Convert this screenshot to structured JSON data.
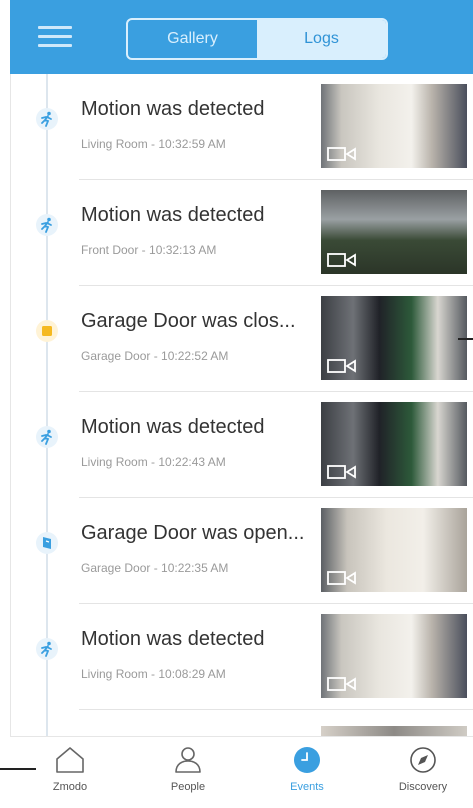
{
  "header": {
    "tabs": [
      {
        "label": "Gallery"
      },
      {
        "label": "Logs"
      }
    ]
  },
  "events": [
    {
      "title": "Motion was detected",
      "subtitle": "Living Room - 10:32:59 AM",
      "type": "motion"
    },
    {
      "title": "Motion was detected",
      "subtitle": "Front Door - 10:32:13 AM",
      "type": "motion"
    },
    {
      "title": "Garage Door was clos...",
      "subtitle": "Garage Door - 10:22:52 AM",
      "type": "garage-closed"
    },
    {
      "title": "Motion was detected",
      "subtitle": "Living Room - 10:22:43 AM",
      "type": "motion"
    },
    {
      "title": "Garage Door was open...",
      "subtitle": "Garage Door - 10:22:35 AM",
      "type": "garage-open"
    },
    {
      "title": "Motion was detected",
      "subtitle": "Living Room - 10:08:29 AM",
      "type": "motion"
    }
  ],
  "tabbar": {
    "items": [
      {
        "label": "Zmodo",
        "icon": "home-icon"
      },
      {
        "label": "People",
        "icon": "person-icon"
      },
      {
        "label": "Events",
        "icon": "clock-icon",
        "active": true
      },
      {
        "label": "Discovery",
        "icon": "compass-icon"
      }
    ]
  },
  "colors": {
    "accent": "#3a9fe0",
    "garage": "#f5b921"
  }
}
